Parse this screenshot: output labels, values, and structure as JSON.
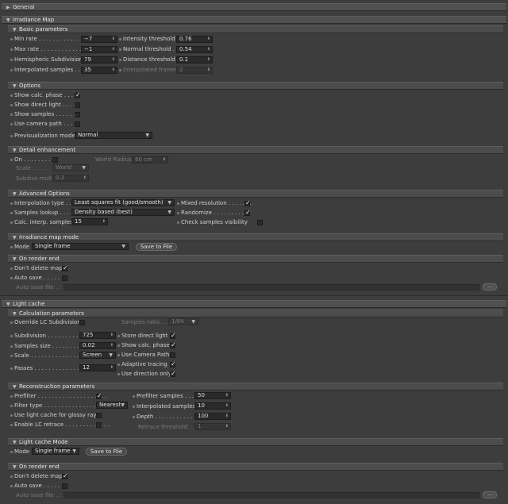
{
  "general": {
    "title": "General"
  },
  "irradiance": {
    "title": "Irradiance Map",
    "basic": {
      "title": "Basic parameters",
      "min_rate": {
        "label": "Min rate",
        "value": "−7"
      },
      "max_rate": {
        "label": "Max rate",
        "value": "−1"
      },
      "hemi": {
        "label": "Hemispheric Subdivision",
        "value": "79"
      },
      "interp": {
        "label": "Interpolated samples",
        "value": "35"
      },
      "intensity": {
        "label": "Intensity threshold",
        "value": "0.76"
      },
      "normal": {
        "label": "Normal threshold",
        "value": "0.54"
      },
      "distance": {
        "label": "Distance threshold",
        "value": "0.1"
      },
      "interp_frames": {
        "label": "Interpolated frames",
        "value": "2"
      }
    },
    "options": {
      "title": "Options",
      "show_calc": {
        "label": "Show calc. phase",
        "checked": true
      },
      "show_direct": {
        "label": "Show direct light",
        "checked": false
      },
      "show_samples": {
        "label": "Show samples",
        "checked": false
      },
      "use_camera": {
        "label": "Use camera path",
        "checked": false
      },
      "previs_label": "Previsualization mode",
      "previs_value": "Normal"
    },
    "detail": {
      "title": "Detail enhancement",
      "on_label": "On",
      "world_radius_label": "World Radius",
      "world_radius_value": "60 cm",
      "scale_label": "Scale",
      "scale_value": "World",
      "subdivs_label": "Subdivs mult.",
      "subdivs_value": "0.3"
    },
    "advanced": {
      "title": "Advanced Options",
      "interp_type_label": "Interpolation type",
      "interp_type_value": "Least squares fit (good/smooth)",
      "lookup_label": "Samples lookup",
      "lookup_value": "Density based (best)",
      "calc_interp_label": "Calc. interp. samples",
      "calc_interp_value": "15",
      "mixed_label": "Mixed resolution",
      "randomize_label": "Randomize",
      "check_vis_label": "Check samples visibility"
    },
    "mode": {
      "title": "Irradiance map mode",
      "mode_label": "Mode",
      "mode_value": "Single frame",
      "save_btn": "Save to File"
    },
    "render_end": {
      "title": "On render end",
      "dont_delete": "Don't delete map",
      "auto_save": "Auto save",
      "auto_save_file": "Auto save file",
      "browse": "..."
    }
  },
  "light_cache": {
    "title": "Light cache",
    "calc": {
      "title": "Calculation parameters",
      "override_label": "Override LC Subdivision",
      "samples_ratio_label": "Samples ratio",
      "samples_ratio_value": "1/64",
      "subdivision_label": "Subdivision",
      "subdivision_value": "725",
      "sample_size_label": "Samples size",
      "sample_size_value": "0.02",
      "scale_label": "Scale",
      "scale_value": "Screen",
      "passes_label": "Passes",
      "passes_value": "12",
      "store_direct": "Store direct light",
      "show_calc": "Show calc. phase",
      "use_camera": "Use Camera Path",
      "adaptive": "Adaptive tracing",
      "use_direction": "Use direction only"
    },
    "recon": {
      "title": "Reconstruction parameters",
      "prefilter": "Prefilter",
      "filter_type_label": "Filter type",
      "filter_type_value": "Nearest",
      "glossy": "Use light cache for glossy rays",
      "retrace": "Enable LC retrace",
      "prefilter_samples_label": "Prefilter samples",
      "prefilter_samples_value": "50",
      "interp_samples_label": "Interpolated samples",
      "interp_samples_value": "10",
      "depth_label": "Depth",
      "depth_value": "100",
      "retrace_thresh_label": "Retrace threshold",
      "retrace_thresh_value": "1"
    },
    "mode": {
      "title": "Light cache Mode",
      "mode_label": "Mode",
      "mode_value": "Single frame",
      "save_btn": "Save to File"
    },
    "render_end": {
      "title": "On render end",
      "dont_delete": "Don't delete map",
      "auto_save": "Auto save",
      "auto_save_file": "Auto save file",
      "browse": "..."
    }
  }
}
